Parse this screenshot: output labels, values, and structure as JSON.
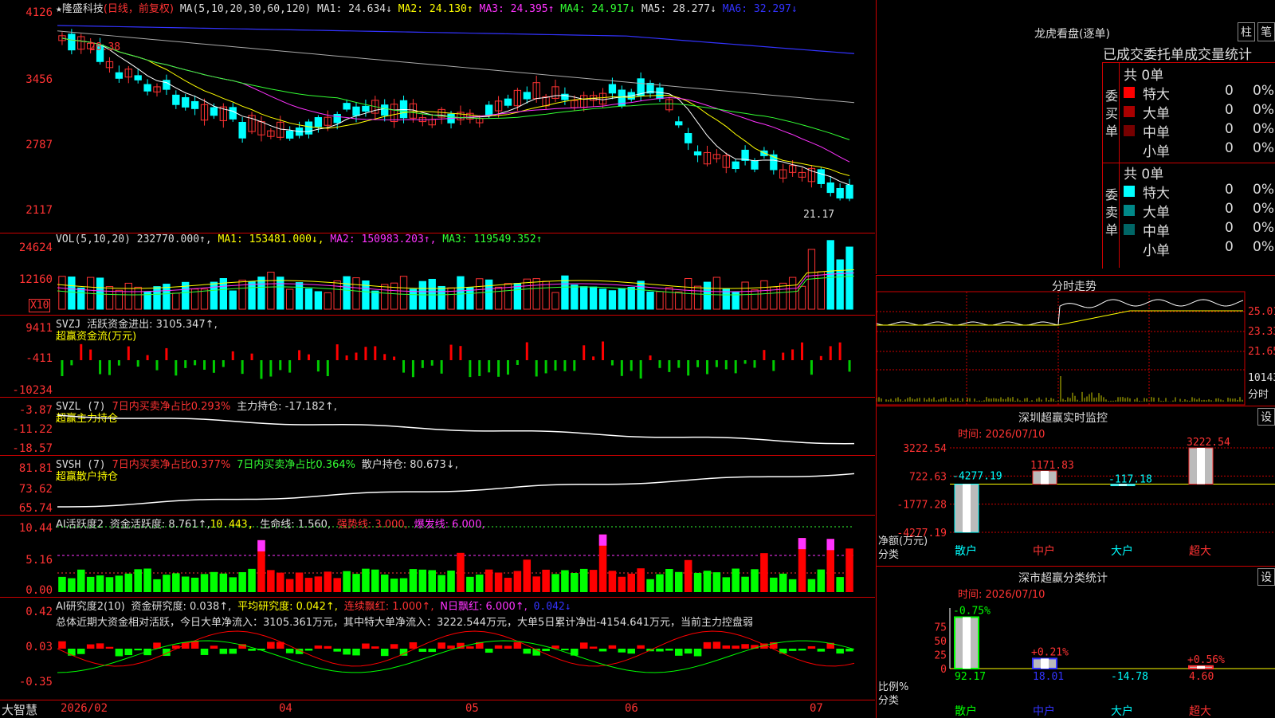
{
  "stock": {
    "star": "★",
    "name": "隆盛科技",
    "mode": "(日线，前复权)"
  },
  "main_header": {
    "prefix": "MA(5,10,20,30,60,120)",
    "ma1": "MA1: 24.634↓",
    "ma2": "MA2: 24.130↑",
    "ma3": "MA3: 24.395↑",
    "ma4": "MA4: 24.917↓",
    "ma5": "MA5: 28.277↓",
    "ma6": "MA6: 32.297↓"
  },
  "main_axis": [
    "4126",
    "3456",
    "2787",
    "2117"
  ],
  "main_annot": {
    "high": "28.38",
    "low": "21.17"
  },
  "vol_header": {
    "prefix": "VOL(5,10,20)",
    "val": "232770.000↑,",
    "ma1": "MA1: 153481.000↓,",
    "ma2": "MA2: 150983.203↑,",
    "ma3": "MA3: 119549.352↑"
  },
  "vol_axis": [
    "24624",
    "12160"
  ],
  "vol_unit": "X10",
  "svzj_header": {
    "prefix": "SVZJ",
    "name": "活跃资金进出: 3105.347↑,",
    "sub": "超赢资金流(万元)"
  },
  "svzj_axis": [
    "9411",
    "-411",
    "-10234"
  ],
  "svzl_header": {
    "prefix": "SVZL (7)",
    "a": "7日内买卖净占比0.293%",
    "b": "主力持仓: -17.182↑,",
    "sub": "超赢主力持仓"
  },
  "svzl_axis": [
    "-3.87",
    "-11.22",
    "-18.57"
  ],
  "svsh_header": {
    "prefix": "SVSH (7)",
    "a": "7日内买卖净占比0.377%",
    "b": "7日内买卖净占比0.364%",
    "c": "散户持仓: 80.673↓,",
    "sub": "超赢散户持仓"
  },
  "svsh_axis": [
    "81.81",
    "73.62",
    "65.74"
  ],
  "ai_header": {
    "prefix": "AI活跃度2",
    "a": "资金活跃度: 8.761↑,",
    "b": "10.443,",
    "c": "生命线: 1.560,",
    "d": "强势线: 3.000,",
    "e": "爆发线: 6.000,"
  },
  "ai_axis": [
    "10.44",
    "5.16",
    "0.00"
  ],
  "ai2_header": {
    "prefix": "AI研究度2(10)",
    "a": "资金研究度: 0.038↑,",
    "b": "平均研究度: 0.042↑,",
    "c": "连续飘红: 1.000↑,",
    "d": "N日飘红: 6.000↑,",
    "e": "0.042↓"
  },
  "ai2_text": "总体近期大资金相对活跃，今日大单净流入：3105.361万元，其中特大单净流入：3222.544万元，大单5日累计净出-4154.641万元，当前主力控盘弱",
  "ai2_axis": [
    "0.42",
    "0.03",
    "-0.35"
  ],
  "bottom": {
    "brand": "大智慧",
    "dates": [
      "2026/02",
      "04",
      "05",
      "06",
      "07"
    ]
  },
  "lhb": {
    "title": "龙虎看盘(逐单)",
    "btn1": "柱",
    "btn2": "笔",
    "subtitle": "已成交委托单成交量统计",
    "buy": {
      "label": "委买单",
      "total": "共 0单",
      "rows": [
        {
          "n": "特大",
          "v": "0",
          "p": "0%",
          "c": "#f00"
        },
        {
          "n": "大单",
          "v": "0",
          "p": "0%",
          "c": "#a00"
        },
        {
          "n": "中单",
          "v": "0",
          "p": "0%",
          "c": "#700"
        },
        {
          "n": "小单",
          "v": "0",
          "p": "0%",
          "c": "#000"
        }
      ]
    },
    "sell": {
      "label": "委卖单",
      "total": "共 0单",
      "rows": [
        {
          "n": "特大",
          "v": "0",
          "p": "0%",
          "c": "#0ff"
        },
        {
          "n": "大单",
          "v": "0",
          "p": "0%",
          "c": "#088"
        },
        {
          "n": "中单",
          "v": "0",
          "p": "0%",
          "c": "#066"
        },
        {
          "n": "小单",
          "v": "0",
          "p": "0%",
          "c": "#000"
        }
      ]
    }
  },
  "fs": {
    "title": "分时走势",
    "axis": [
      "25.01",
      "23.33",
      "21.65",
      "10143"
    ],
    "unit": "分时"
  },
  "sz_mon": {
    "title": "深圳超赢实时监控",
    "btn": "设",
    "time": "时间: 2026/07/10",
    "axis": [
      "3222.54",
      "722.63",
      "-1777.28",
      "-4277.19"
    ],
    "ylab": "净额(万元)",
    "xlab": "分类",
    "bars": [
      {
        "n": "散户",
        "v": -4277.19,
        "label": "-4277.19"
      },
      {
        "n": "中户",
        "v": 1171.83,
        "label": "1171.83"
      },
      {
        "n": "大户",
        "v": -117.18,
        "label": "-117.18"
      },
      {
        "n": "超大",
        "v": 3222.54,
        "label": "3222.54"
      }
    ]
  },
  "sz_cls": {
    "title": "深市超赢分类统计",
    "btn": "设",
    "time": "时间: 2026/07/10",
    "axis": [
      "75",
      "50",
      "25",
      "0"
    ],
    "ylab": "比例%",
    "xlab": "分类",
    "bars": [
      {
        "n": "散户",
        "v": 92.17,
        "top": "-0.75%",
        "label": "92.17"
      },
      {
        "n": "中户",
        "v": 18.01,
        "top": "+0.21%",
        "label": "18.01"
      },
      {
        "n": "大户",
        "v": -14.78,
        "top": "",
        "label": "-14.78"
      },
      {
        "n": "超大",
        "v": 4.6,
        "top": "+0.56%",
        "label": "4.60"
      }
    ]
  },
  "chart_data": {
    "type": "bar",
    "title": "深圳超赢实时监控",
    "categories": [
      "散户",
      "中户",
      "大户",
      "超大"
    ],
    "values": [
      -4277.19,
      1171.83,
      -117.18,
      3222.54
    ],
    "ylabel": "净额(万元)",
    "xlabel": "分类"
  }
}
